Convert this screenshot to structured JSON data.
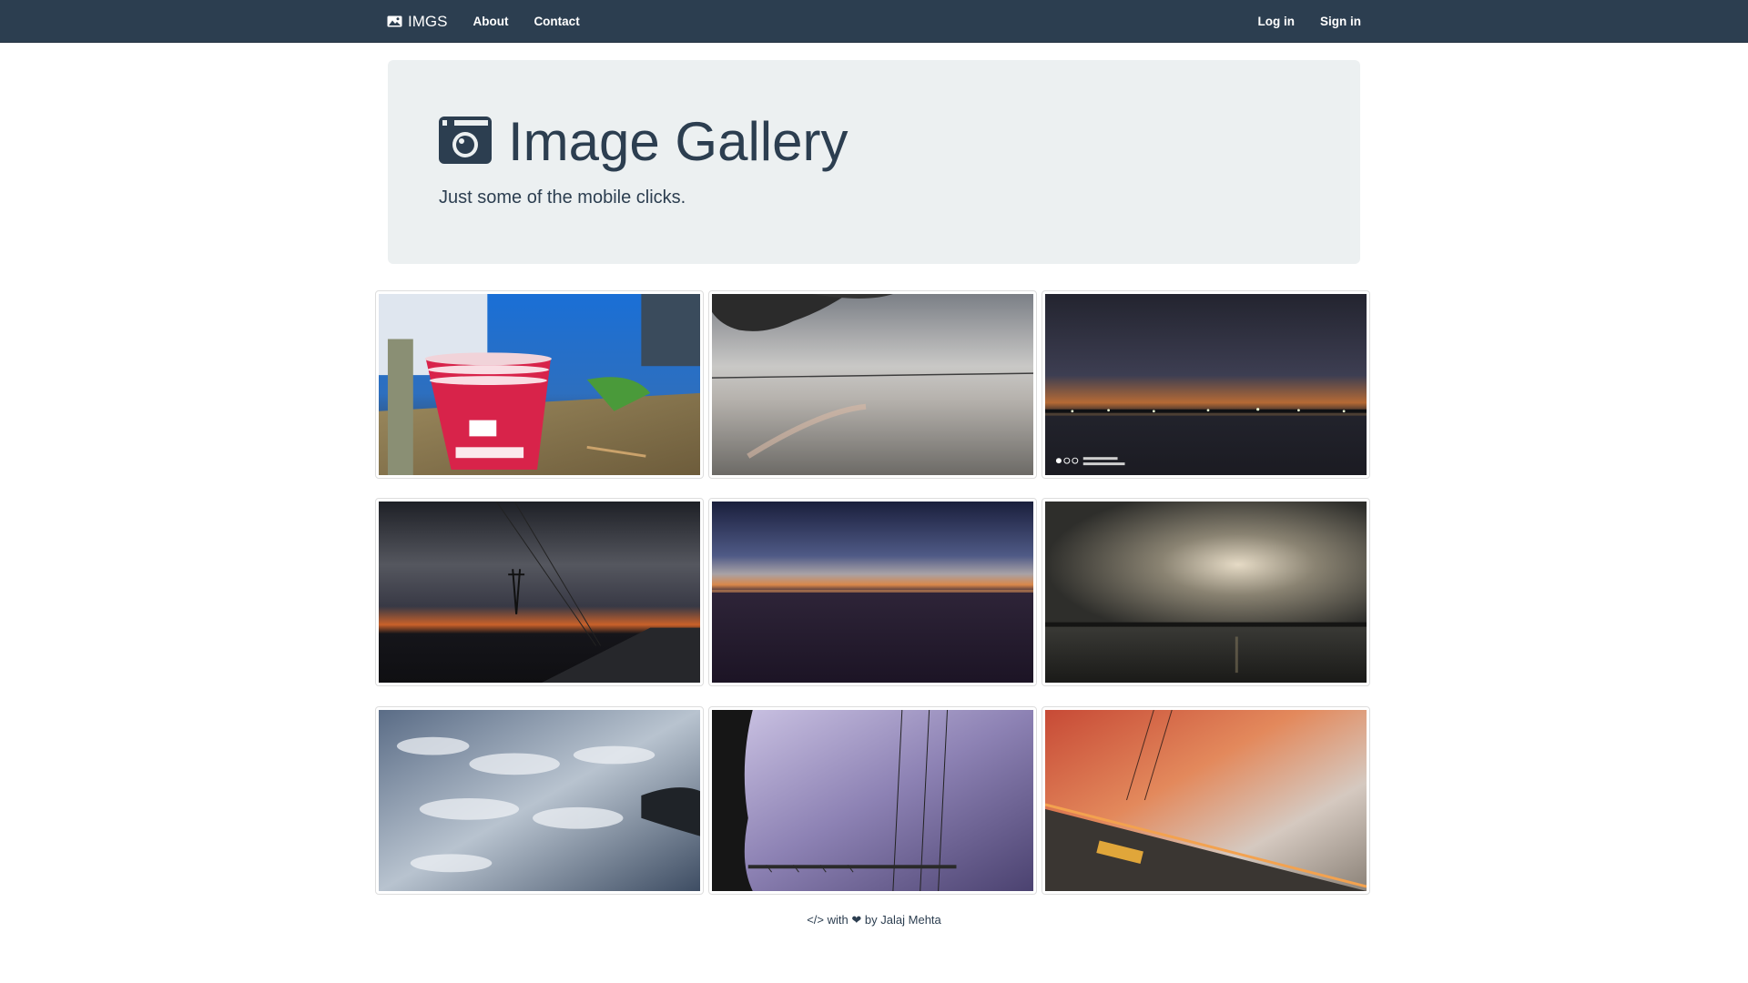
{
  "navbar": {
    "brand_label": "IMGS",
    "brand_icon": "image-icon",
    "links": [
      {
        "label": "About"
      },
      {
        "label": "Contact"
      }
    ],
    "right_links": [
      {
        "label": "Log in"
      },
      {
        "label": "Sign in"
      }
    ],
    "background_color": "#2c3e50"
  },
  "jumbotron": {
    "title": "Image Gallery",
    "title_icon": "camera-icon",
    "subtitle": "Just some of the mobile clicks.",
    "background_color": "#ecf0f1"
  },
  "gallery": {
    "photos": [
      {
        "subject": "paper-cups-photo"
      },
      {
        "subject": "lake-dawn-photo"
      },
      {
        "subject": "night-shoreline-photo",
        "watermark": "SHOT ON MI A2\nBY JALAJ MEHTA"
      },
      {
        "subject": "power-lines-sunset-photo"
      },
      {
        "subject": "horizon-twilight-photo"
      },
      {
        "subject": "stormy-lake-photo"
      },
      {
        "subject": "cloud-pattern-photo"
      },
      {
        "subject": "violet-sky-wires-photo"
      },
      {
        "subject": "orange-sunset-photo"
      }
    ]
  },
  "footer": {
    "code_symbol": "</>",
    "with_text": "with",
    "heart_icon": "heart-icon",
    "by_text": "by",
    "author": "Jalaj Mehta"
  }
}
